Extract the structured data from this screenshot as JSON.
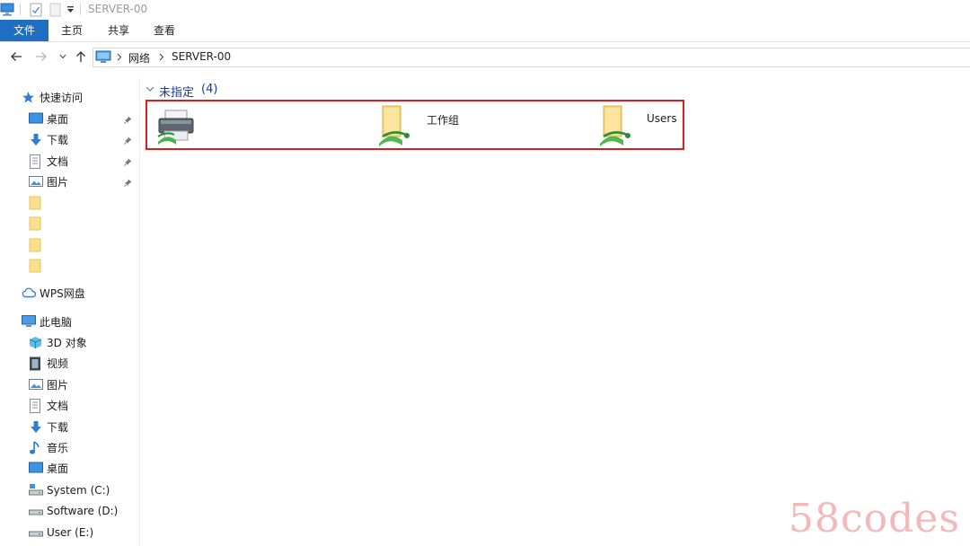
{
  "window": {
    "title": "SERVER-00"
  },
  "ribbon": {
    "tabs": [
      "文件",
      "主页",
      "共享",
      "查看"
    ]
  },
  "address": {
    "crumbs": [
      "网络",
      "SERVER-00"
    ]
  },
  "sidebar": {
    "quick_access": "快速访问",
    "pinned": [
      "桌面",
      "下载",
      "文档",
      "图片"
    ],
    "wps": "WPS网盘",
    "this_pc": "此电脑",
    "pc_items": [
      "3D 对象",
      "视频",
      "图片",
      "文档",
      "下载",
      "音乐",
      "桌面",
      "System (C:)",
      "Software (D:)",
      "User (E:)"
    ]
  },
  "content": {
    "group_label": "未指定",
    "group_count": "(4)",
    "items": [
      "",
      "工作组",
      "Users"
    ]
  },
  "watermark": "58codes",
  "colors": {
    "accent": "#1e6fc2",
    "selection": "#d81e1e",
    "group_header": "#1e3c8c"
  }
}
